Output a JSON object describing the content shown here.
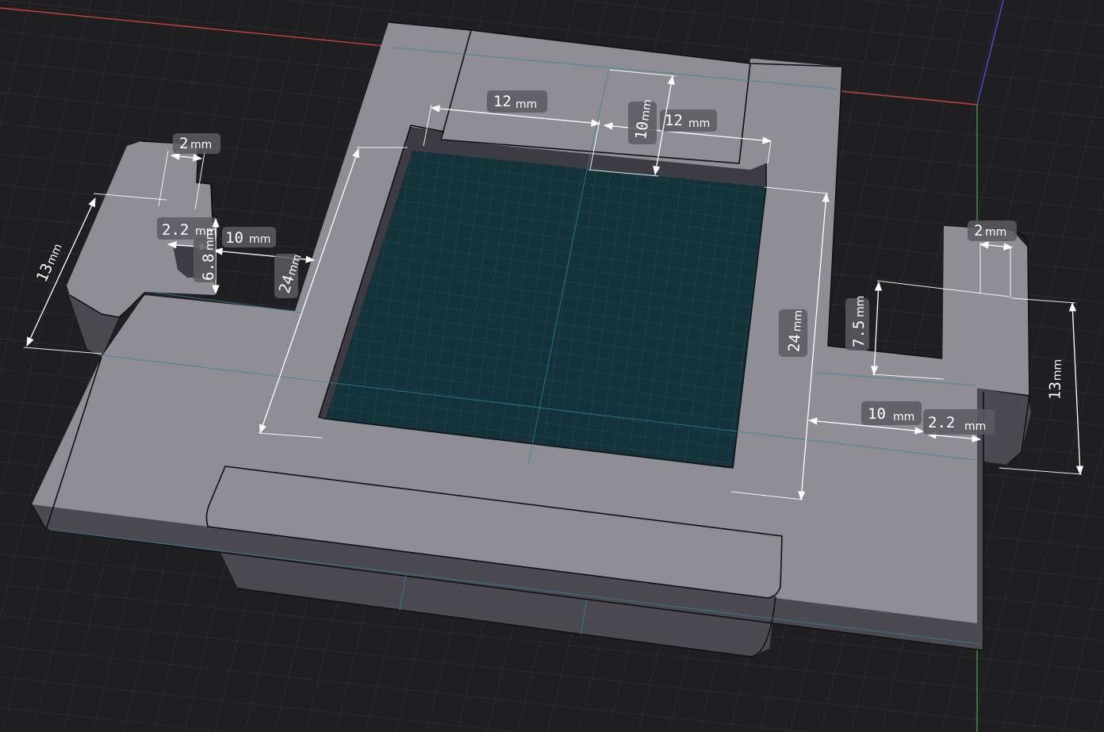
{
  "viewport": {
    "background": "#1f1f22",
    "axis_colors": {
      "x": "#c8423a",
      "y": "#3a9a4a",
      "z": "#3a5ad0"
    },
    "model_color": "#8e8e94",
    "pocket_color": "#14323a"
  },
  "dimensions": {
    "left_tab_width": "2",
    "left_tab_height": "13",
    "left_gap": "2.2",
    "left_slot": "6.8",
    "left_arm_length": "10",
    "left_frame_width": "24",
    "top_left_width": "12",
    "top_right_width": "12",
    "top_depth": "10",
    "right_frame_height": "24",
    "right_tab_width": "2",
    "right_slot": "7.5",
    "right_tab_height": "13",
    "right_arm_length": "10",
    "right_gap": "2.2"
  },
  "unit": "mm"
}
